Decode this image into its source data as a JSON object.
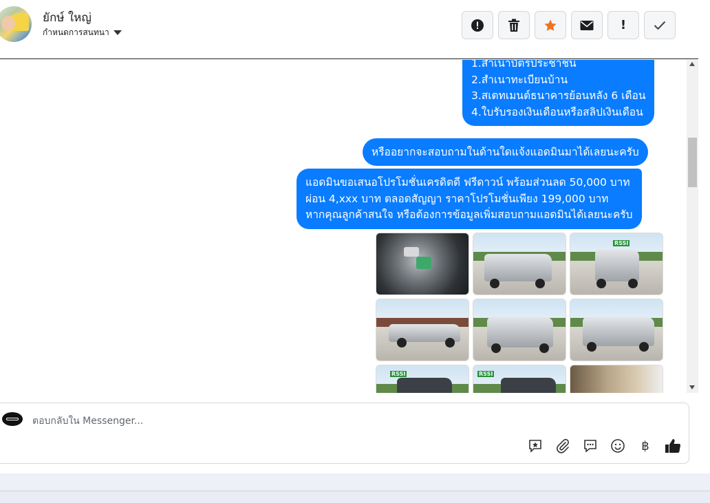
{
  "header": {
    "name": "ยักษ์ ใหญ่",
    "assign_label": "กำหนดการสนทนา"
  },
  "actions": [
    {
      "icon": "spam-icon",
      "glyph": "!"
    },
    {
      "icon": "trash-icon",
      "glyph": ""
    },
    {
      "icon": "star-icon",
      "glyph": "★"
    },
    {
      "icon": "envelope-icon",
      "glyph": ""
    },
    {
      "icon": "follow-up-icon",
      "glyph": "!"
    },
    {
      "icon": "check-icon",
      "glyph": "✓"
    }
  ],
  "messages": {
    "docs_lines": [
      "1.สำเนาบัตรประชาชน",
      "2.สำเนาทะเบียนบ้าน",
      "3.สเตทเมนต์ธนาคารย้อนหลัง 6 เดือน",
      "4.ใบรับรองเงินเดือนหรือสลิปเงินเดือน"
    ],
    "ask": "หรืออยากจะสอบถามในด้านใดแจ้งแอดมินมาได้เลยนะครับ",
    "promo_lines": [
      "แอดมินขอเสนอโปรโมชั่นเครดิตดี ฟรีดาวน์ พร้อมส่วนลด 50,000 บาท",
      "ผ่อน 4,xxx บาท ตลอดสัญญา ราคาโปรโมชั่นเพียง 199,000 บาท",
      "หากคุณลูกค้าสนใจ หรือต้องการข้อมูลเพิ่มสอบถามแอดมินได้เลยนะครับ"
    ],
    "sign_text": "RSSI"
  },
  "composer": {
    "placeholder": "ตอบกลับใน Messenger..."
  },
  "tools": [
    {
      "name": "saved-reply-icon"
    },
    {
      "name": "attachment-icon"
    },
    {
      "name": "chat-bubble-icon"
    },
    {
      "name": "emoji-icon"
    },
    {
      "name": "baht-payment-icon",
      "glyph": "฿"
    },
    {
      "name": "thumbs-up-icon"
    }
  ],
  "colors": {
    "bubble": "#0a7cff",
    "accent_star": "#f2711c"
  }
}
